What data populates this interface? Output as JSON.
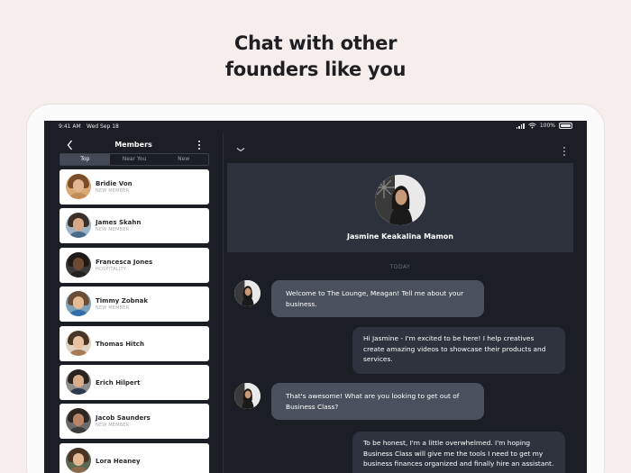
{
  "headline": {
    "line1": "Chat with other",
    "line2": "founders like you"
  },
  "status_bar": {
    "time": "9:41 AM",
    "date": "Wed Sep 18",
    "battery": "100%"
  },
  "members_panel": {
    "title": "Members",
    "tabs": [
      {
        "label": "Top",
        "active": true
      },
      {
        "label": "Near You",
        "active": false
      },
      {
        "label": "New",
        "active": false
      }
    ],
    "members": [
      {
        "name": "Bridie Von",
        "subtitle": "NEW MEMBER",
        "hair": "#7a4d2a",
        "skin": "#e2b48f",
        "shirt": "#c28c5a",
        "bg": "#d9a874"
      },
      {
        "name": "James Skahn",
        "subtitle": "NEW MEMBER",
        "hair": "#3a3028",
        "skin": "#d7a886",
        "shirt": "#4a6a8a",
        "bg": "#9fb3c4"
      },
      {
        "name": "Francesca Jones",
        "subtitle": "HOSPITALITY",
        "hair": "#1f1a17",
        "skin": "#6e4a33",
        "shirt": "#222222",
        "bg": "#3a3a3a"
      },
      {
        "name": "Timmy Zobnak",
        "subtitle": "NEW MEMBER",
        "hair": "#6b4d35",
        "skin": "#e5bb96",
        "shirt": "#2f6ea8",
        "bg": "#7da0b8"
      },
      {
        "name": "Thomas Hitch",
        "subtitle": "",
        "hair": "#4a3627",
        "skin": "#e8c0a0",
        "shirt": "#aa7a55",
        "bg": "#e0d2c0"
      },
      {
        "name": "Erich Hilpert",
        "subtitle": "",
        "hair": "#2b2320",
        "skin": "#d9ad8c",
        "shirt": "#2d3a4d",
        "bg": "#8d8d8d"
      },
      {
        "name": "Jacob Saunders",
        "subtitle": "NEW MEMBER",
        "hair": "#2e2620",
        "skin": "#b98566",
        "shirt": "#3c3c3c",
        "bg": "#6b6b6b"
      },
      {
        "name": "Lora Heaney",
        "subtitle": "",
        "hair": "#4b3325",
        "skin": "#e3b995",
        "shirt": "#8a6a4a",
        "bg": "#5a6a50"
      }
    ]
  },
  "chat": {
    "contact_name": "Jasmine Keakalina Mamon",
    "day_label": "TODAY",
    "messages": [
      {
        "direction": "in",
        "text": "Welcome to The Lounge, Meagan! Tell me about your business."
      },
      {
        "direction": "out",
        "text": "Hi Jasmine - I'm excited to be here! I help creatives create amazing videos to showcase their products and services."
      },
      {
        "direction": "in",
        "text": "That's awesome! What are you looking to get out of Business Class?"
      },
      {
        "direction": "out",
        "text": "To be honest, I'm a little overwhelmed. I'm hoping Business Class will give me the tools I need to get my business finances organized and finally hire an assistant."
      }
    ]
  },
  "icons": {
    "back": "chevron-left-icon",
    "more": "more-vertical-icon",
    "collapse": "chevron-down-icon",
    "signal": "signal-icon",
    "wifi": "wifi-icon",
    "battery": "battery-icon"
  }
}
